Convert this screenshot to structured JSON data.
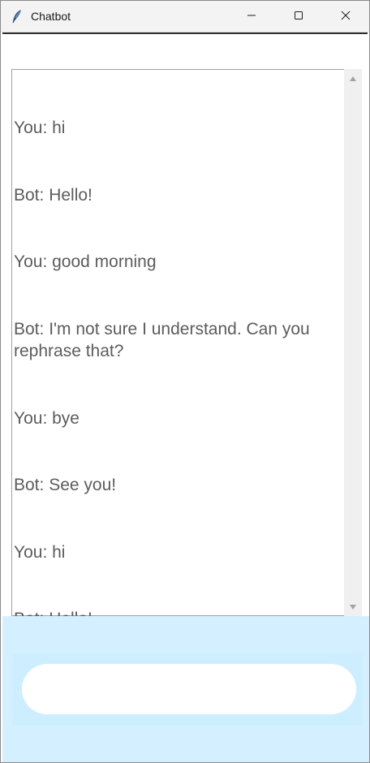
{
  "window": {
    "title": "Chatbot",
    "icon": "feather-icon"
  },
  "controls": {
    "minimize_icon": "minimize-icon",
    "maximize_icon": "maximize-icon",
    "close_icon": "close-icon"
  },
  "chat": {
    "lines": [
      "You: hi",
      "Bot: Hello!",
      "You: good morning",
      "Bot: I'm not sure I understand. Can you rephrase that?",
      "You: bye",
      "Bot: See you!",
      "You: hi",
      "Bot: Hello!"
    ]
  },
  "input": {
    "value": "",
    "placeholder": ""
  },
  "colors": {
    "panel_background": "#d4efff",
    "chat_text": "#5c5c5c",
    "input_background": "#ffffff"
  }
}
